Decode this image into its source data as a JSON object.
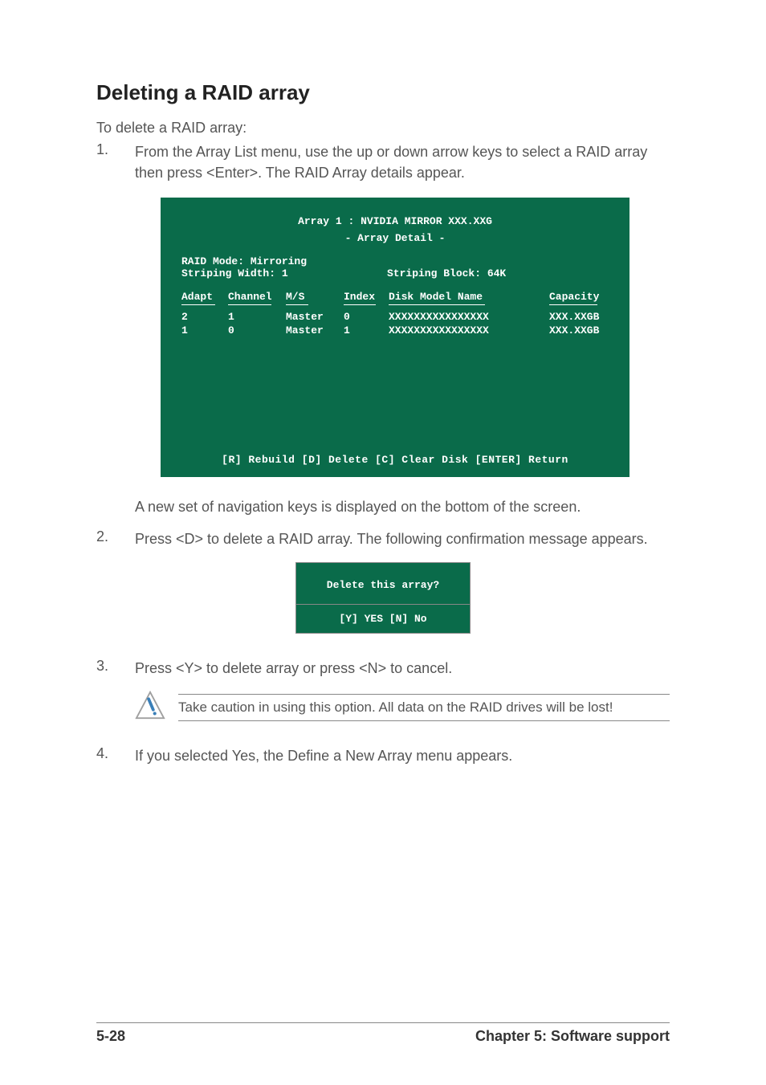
{
  "heading": "Deleting a RAID array",
  "intro": "To delete a RAID array:",
  "steps": {
    "s1": {
      "num": "1.",
      "text": "From the Array List menu, use the up or down arrow keys to select a RAID array then press <Enter>. The RAID Array details appear."
    },
    "s1_continued": "A new set of  navigation keys is displayed on the bottom of the screen.",
    "s2": {
      "num": "2.",
      "text": "Press <D> to delete a RAID array. The following confirmation message appears."
    },
    "s3": {
      "num": "3.",
      "text": "Press <Y> to delete array or press <N> to cancel."
    },
    "s4": {
      "num": "4.",
      "text": "If you selected Yes, the Define a New Array menu appears."
    }
  },
  "terminal": {
    "title_line1": "Array 1 : NVIDIA MIRROR  XXX.XXG",
    "title_line2": "- Array Detail -",
    "raid_mode": "RAID Mode: Mirroring",
    "striping_width": "Striping Width: 1",
    "striping_block": "Striping Block: 64K",
    "headers": {
      "adapt": "Adapt",
      "channel": "Channel",
      "ms": "M/S",
      "index": "Index",
      "model": "Disk Model Name",
      "capacity": "Capacity"
    },
    "rows": [
      {
        "adapt": "2",
        "channel": "1",
        "ms": "Master",
        "index": "0",
        "model": "XXXXXXXXXXXXXXXX",
        "capacity": "XXX.XXGB"
      },
      {
        "adapt": "1",
        "channel": "0",
        "ms": "Master",
        "index": "1",
        "model": "XXXXXXXXXXXXXXXX",
        "capacity": "XXX.XXGB"
      }
    ],
    "footer": "[R] Rebuild  [D] Delete  [C] Clear Disk  [ENTER] Return"
  },
  "confirm": {
    "question": "Delete this array?",
    "options": "[Y] YES   [N] No"
  },
  "alert": "Take caution in using this option. All data on the RAID drives will be lost!",
  "footer": {
    "page": "5-28",
    "chapter": "Chapter 5: Software support"
  }
}
